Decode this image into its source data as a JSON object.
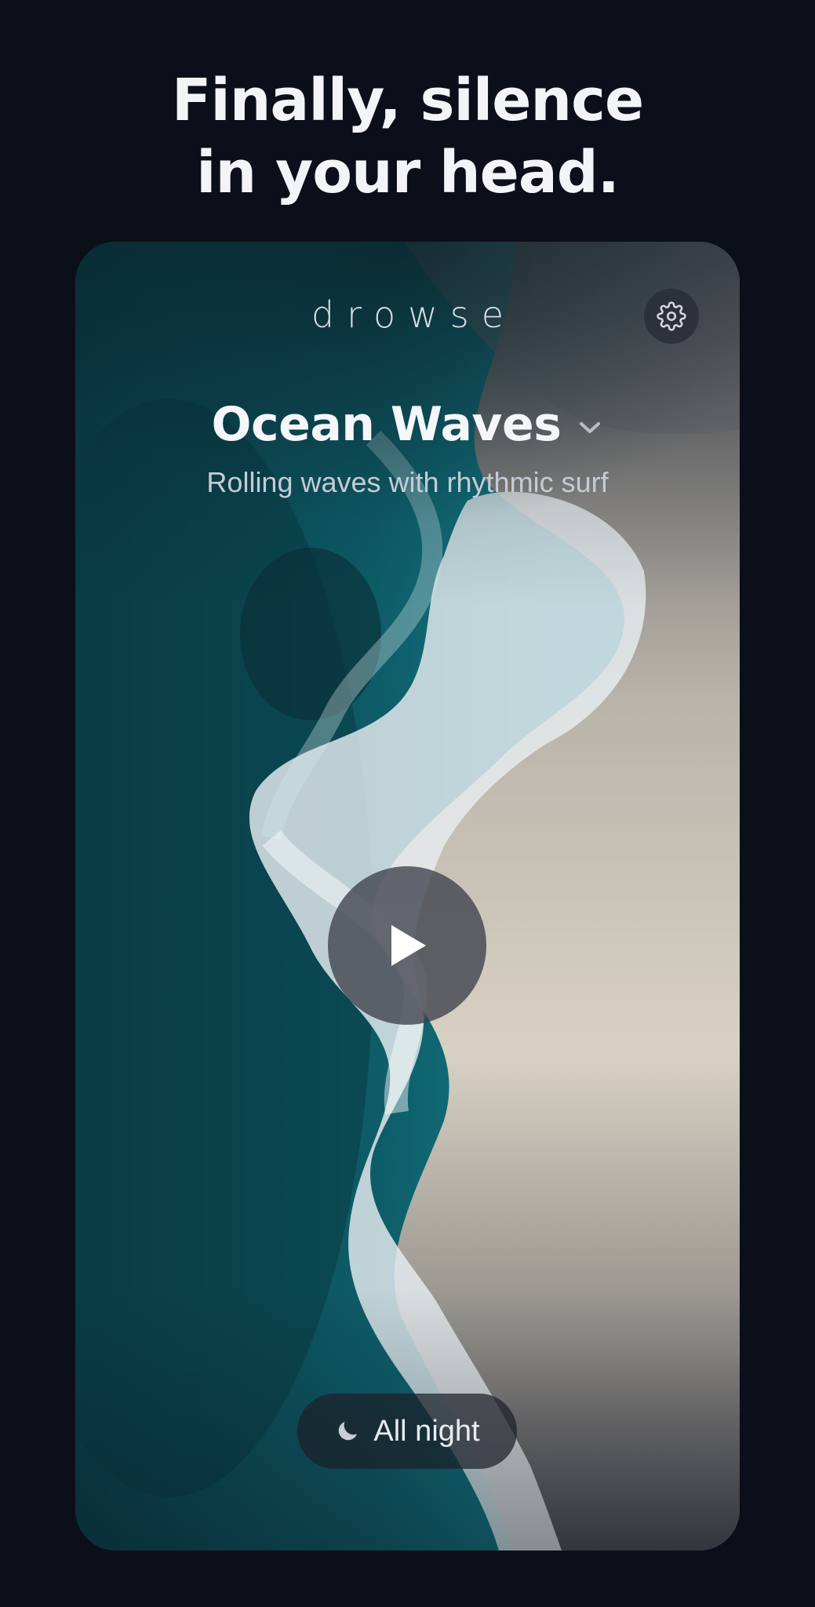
{
  "headline": {
    "line1": "Finally, silence",
    "line2": "in your head."
  },
  "player": {
    "brand": "drowse",
    "sound_title": "Ocean Waves",
    "sound_subtitle": "Rolling waves with rhythmic surf",
    "timer_label": "All night"
  },
  "icons": {
    "settings": "gear-icon",
    "dropdown": "chevron-down-icon",
    "play": "play-icon",
    "timer": "moon-icon"
  },
  "colors": {
    "background": "#0b0f1a",
    "ocean": "#0d5a66",
    "sand": "#d9d3c6",
    "text": "#f2f4f8"
  }
}
